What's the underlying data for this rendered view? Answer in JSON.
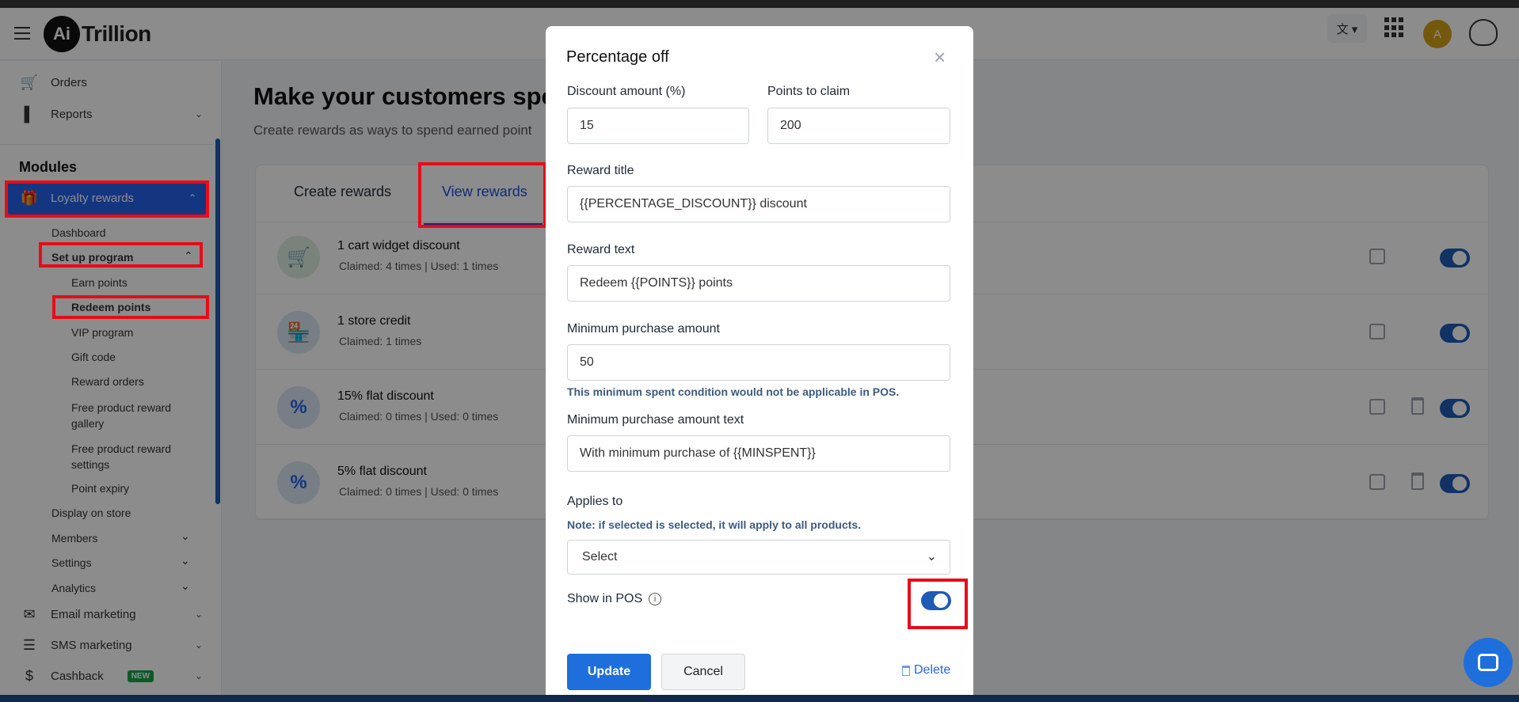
{
  "header": {
    "logo_mark": "Ai",
    "logo_text": "Trillion",
    "lang_icon": "translate-icon",
    "avatar_initial": "A"
  },
  "sidebar": {
    "orders": "Orders",
    "reports": "Reports",
    "modules_title": "Modules",
    "loyalty_rewards": "Loyalty rewards",
    "dashboard": "Dashboard",
    "setup_program": "Set up program",
    "earn_points": "Earn points",
    "redeem_points": "Redeem points",
    "vip_program": "VIP program",
    "gift_code": "Gift code",
    "reward_orders": "Reward orders",
    "free_product_gallery_1": "Free product reward",
    "free_product_gallery_2": "gallery",
    "free_product_settings_1": "Free product reward",
    "free_product_settings_2": "settings",
    "point_expiry": "Point expiry",
    "display_on_store": "Display on store",
    "members": "Members",
    "settings": "Settings",
    "analytics": "Analytics",
    "email_marketing": "Email marketing",
    "sms_marketing": "SMS marketing",
    "cashback": "Cashback",
    "new_badge": "NEW"
  },
  "main": {
    "title": "Make your customers spen",
    "subtitle": "Create rewards as ways to spend earned point",
    "tabs": [
      {
        "label": "Create rewards"
      },
      {
        "label": "View rewards"
      }
    ],
    "rewards": [
      {
        "name": "1 cart widget discount",
        "meta": "Claimed: 4 times  |  Used: 1 times",
        "icon": "cart-icon",
        "icon_glyph": "🛒",
        "icon_color": "#2e9e4f",
        "icon_bg": "#dcefe0"
      },
      {
        "name": "1 store credit",
        "meta": "Claimed: 1 times",
        "icon": "store-icon",
        "icon_glyph": "🏪",
        "icon_color": "#1e5bb6",
        "icon_bg": "#dbe6f3"
      },
      {
        "name": "15% flat discount",
        "meta": "Claimed: 0 times  |  Used: 0 times",
        "icon": "percent-icon",
        "icon_glyph": "%",
        "icon_color": "#2563eb",
        "icon_bg": "#dbe6f3"
      },
      {
        "name": "5% flat discount",
        "meta": "Claimed: 0 times  |  Used: 0 times",
        "icon": "percent-icon",
        "icon_glyph": "%",
        "icon_color": "#2563eb",
        "icon_bg": "#dbe6f3"
      }
    ]
  },
  "modal": {
    "title": "Percentage off",
    "close_glyph": "×",
    "discount_label": "Discount amount (%)",
    "discount_value": "15",
    "points_label": "Points to claim",
    "points_value": "200",
    "reward_title_label": "Reward title",
    "reward_title_value": "{{PERCENTAGE_DISCOUNT}} discount",
    "reward_text_label": "Reward text",
    "reward_text_value": "Redeem {{POINTS}} points",
    "min_purchase_label": "Minimum purchase amount",
    "min_purchase_value": "50",
    "min_purchase_note": "This minimum spent condition would not be applicable in POS.",
    "min_purchase_text_label": "Minimum purchase amount text",
    "min_purchase_text_value": "With minimum purchase of {{MINSPENT}}",
    "applies_to_label": "Applies to",
    "applies_to_note": "Note: if selected is selected, it will apply to all products.",
    "applies_to_value": "Select",
    "show_pos_label": "Show in POS",
    "show_pos_enabled": true,
    "update_label": "Update",
    "cancel_label": "Cancel",
    "delete_label": "Delete"
  },
  "colors": {
    "accent": "#1e6fdb",
    "highlight_box": "#e80b1a",
    "toggle_on": "#1e5bb6"
  }
}
